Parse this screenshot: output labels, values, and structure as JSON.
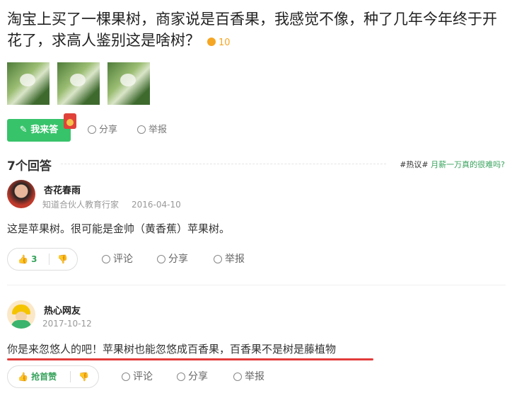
{
  "question": {
    "title": "淘宝上买了一棵果树，商家说是百香果，我感觉不像，种了几年今年终于开花了，求高人鉴别这是啥树？",
    "reward": "10",
    "actions": {
      "answer": "我来答",
      "share": "分享",
      "report": "举报"
    }
  },
  "answers_header": {
    "count_label": "7个回答",
    "hot_tag": "#热议#",
    "hot_link": "月薪一万真的很难吗?"
  },
  "answers": [
    {
      "user": "杏花春雨",
      "title": "知道合伙人教育行家",
      "date": "2016-04-10",
      "content": "这是苹果树。很可能是金帅（黄香蕉）苹果树。",
      "likes": "3",
      "comment": "评论",
      "share": "分享",
      "report": "举报"
    },
    {
      "user": "热心网友",
      "date": "2017-10-12",
      "content": "你是来忽悠人的吧！苹果树也能忽悠成百香果，百香果不是树是藤植物",
      "likes": "抢首赞",
      "comment": "评论",
      "share": "分享",
      "report": "举报"
    }
  ]
}
